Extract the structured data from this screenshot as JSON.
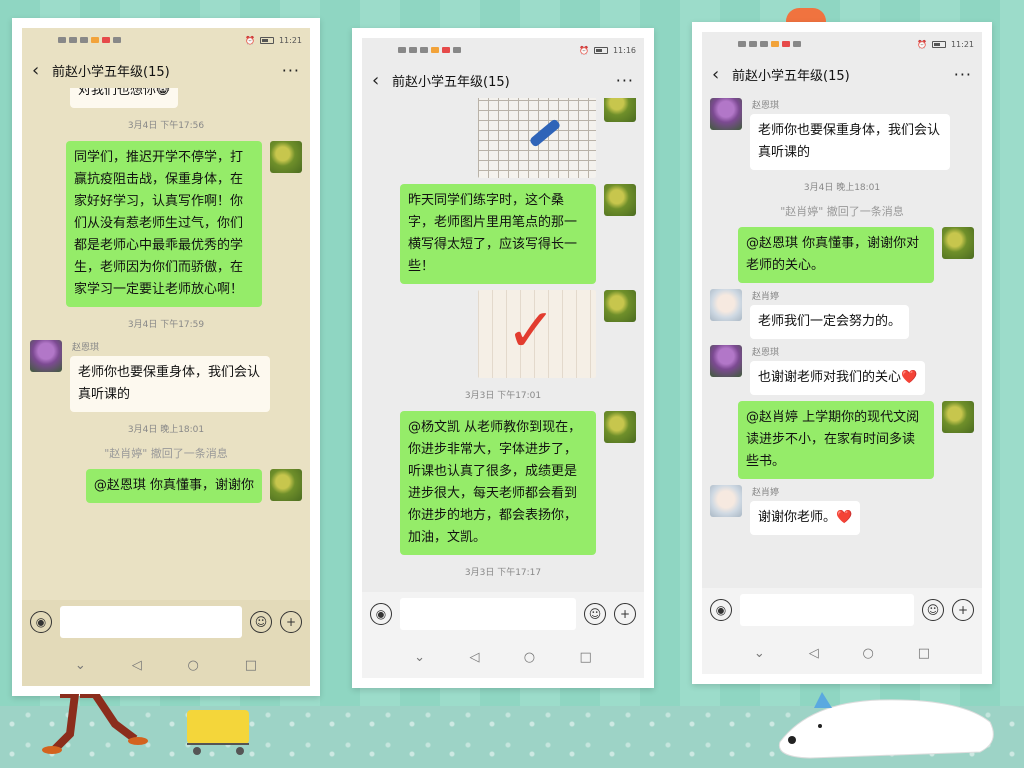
{
  "phones": [
    {
      "status": {
        "time": "11:21"
      },
      "header": {
        "title": "前赵小学五年级(15)",
        "more_label": "···",
        "back_label": "‹"
      },
      "messages": [
        {
          "kind": "incoming_partial",
          "text": "对我们也想你😸"
        },
        {
          "kind": "time",
          "text": "3月4日 下午17:56"
        },
        {
          "kind": "outgoing",
          "text": "同学们，推迟开学不停学，打赢抗疫阻击战，保重身体，在家好好学习，认真写作啊！你们从没有惹老师生过气，你们都是老师心中最乖最优秀的学生，老师因为你们而骄傲，在家学习一定要让老师放心啊！"
        },
        {
          "kind": "time",
          "text": "3月4日 下午17:59"
        },
        {
          "kind": "incoming",
          "name": "赵恩琪",
          "text": "老师你也要保重身体，我们会认真听课的"
        },
        {
          "kind": "time",
          "text": "3月4日 晚上18:01"
        },
        {
          "kind": "recall",
          "text": "\"赵肖婷\" 撤回了一条消息"
        },
        {
          "kind": "outgoing",
          "text": "@赵恩琪  你真懂事，谢谢你"
        }
      ]
    },
    {
      "status": {
        "time": "11:16"
      },
      "header": {
        "title": "前赵小学五年级(15)",
        "more_label": "···",
        "back_label": "‹"
      },
      "messages": [
        {
          "kind": "photo_grid"
        },
        {
          "kind": "outgoing",
          "text": "昨天同学们练字时，这个桑字，老师图片里用笔点的那一横写得太短了，应该写得长一些！"
        },
        {
          "kind": "photo_red"
        },
        {
          "kind": "time",
          "text": "3月3日 下午17:01"
        },
        {
          "kind": "outgoing",
          "text": "@杨文凯  从老师教你到现在，你进步非常大，字体进步了，听课也认真了很多，成绩更是进步很大，每天老师都会看到你进步的地方，都会表扬你，加油，文凯。"
        },
        {
          "kind": "time",
          "text": "3月3日 下午17:17"
        }
      ]
    },
    {
      "status": {
        "time": "11:21"
      },
      "header": {
        "title": "前赵小学五年级(15)",
        "more_label": "···",
        "back_label": "‹"
      },
      "messages": [
        {
          "kind": "incoming",
          "name": "赵恩琪",
          "text": "老师你也要保重身体，我们会认真听课的"
        },
        {
          "kind": "time",
          "text": "3月4日 晚上18:01"
        },
        {
          "kind": "recall",
          "text": "\"赵肖婷\" 撤回了一条消息"
        },
        {
          "kind": "outgoing",
          "text": "@赵恩琪  你真懂事，谢谢你对老师的关心。"
        },
        {
          "kind": "incoming",
          "name": "赵肖婷",
          "text": "老师我们一定会努力的。"
        },
        {
          "kind": "incoming",
          "name": "赵恩琪",
          "text": "也谢谢老师对我们的关心❤️"
        },
        {
          "kind": "outgoing",
          "text": "@赵肖婷  上学期你的现代文阅读进步不小，在家有时间多读些书。"
        },
        {
          "kind": "incoming",
          "name": "赵肖婷",
          "text": "谢谢你老师。❤️"
        }
      ]
    }
  ],
  "icons": {
    "voice": "voice-icon",
    "emoji": "emoji-icon",
    "plus": "plus-icon",
    "nav_back": "nav-back-icon",
    "nav_home": "nav-home-icon",
    "nav_recent": "nav-recent-icon",
    "nav_down": "nav-down-icon"
  },
  "colors": {
    "outgoing_bubble": "#95ec69",
    "incoming_bubble": "#ffffff",
    "background": "#8fd6c2"
  }
}
